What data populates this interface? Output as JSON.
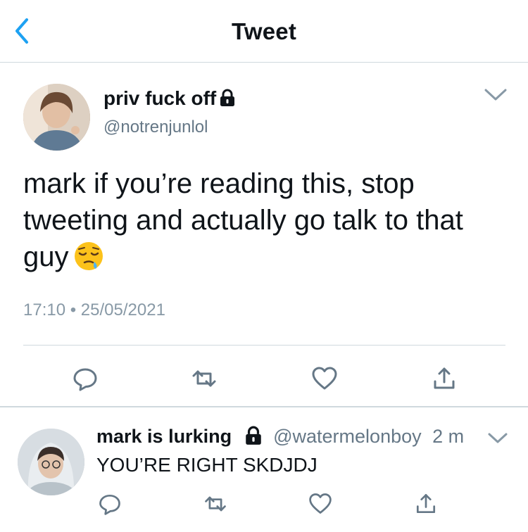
{
  "header": {
    "title": "Tweet",
    "back_icon": "chevron-left-icon"
  },
  "main_tweet": {
    "display_name": "priv fuck off",
    "handle": "@notrenjunlol",
    "text": "mark if you’re reading this, stop tweeting and actually go talk to that guy",
    "emoji": "sleepy-face-emoji",
    "timestamp": "17:10 • 25/05/2021",
    "actions": [
      "reply-icon",
      "retweet-icon",
      "like-icon",
      "share-icon"
    ]
  },
  "reply_tweet": {
    "display_name": "mark is lurking",
    "handle": "@watermelonboy",
    "time": "2 m",
    "text": "YOU’RE RIGHT SKDJDJ",
    "actions": [
      "reply-icon",
      "retweet-icon",
      "like-icon",
      "share-icon"
    ]
  },
  "colors": {
    "accent": "#1da1f2",
    "icon_gray": "#657786",
    "text": "#0f1419",
    "divider": "#cfd9de"
  }
}
